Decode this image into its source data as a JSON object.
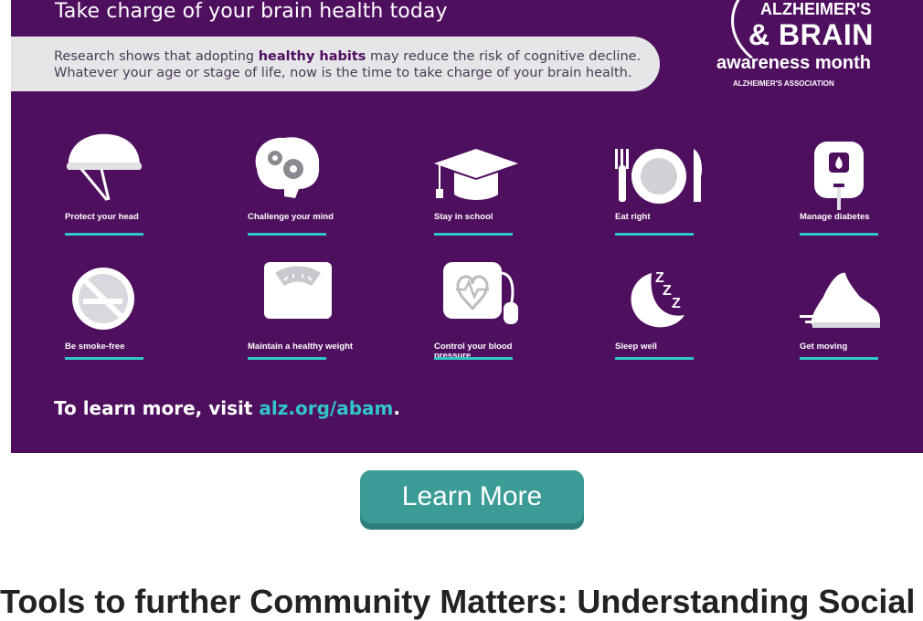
{
  "banner": {
    "title": "Take charge of your brain health today",
    "pill_pre": "Research shows that adopting ",
    "pill_bold": "healthy habits",
    "pill_post": " may reduce the risk of cognitive decline.",
    "pill_line2": "Whatever your age or stage of life, now is the time to take charge of your brain health.",
    "logo": {
      "line1": "ALZHEIMER'S",
      "line2": "& BRAIN",
      "line3": "awareness month",
      "line4": "ALZHEIMER'S ASSOCIATION"
    },
    "tiles": [
      {
        "icon": "helmet-icon",
        "label": "Protect your head"
      },
      {
        "icon": "brain-gears-icon",
        "label": "Challenge your mind"
      },
      {
        "icon": "graduation-cap-icon",
        "label": "Stay in school"
      },
      {
        "icon": "plate-fork-knife-icon",
        "label": "Eat right"
      },
      {
        "icon": "glucose-meter-icon",
        "label": "Manage diabetes"
      },
      {
        "icon": "no-smoking-icon",
        "label": "Be smoke-free"
      },
      {
        "icon": "scale-icon",
        "label": "Maintain a healthy weight"
      },
      {
        "icon": "blood-pressure-monitor-icon",
        "label": "Control your blood pressure"
      },
      {
        "icon": "moon-zzz-icon",
        "label": "Sleep well"
      },
      {
        "icon": "sneaker-icon",
        "label": "Get moving"
      }
    ],
    "learn_pre": "To learn more, visit ",
    "learn_link": "alz.org/abam",
    "learn_post": "."
  },
  "button": {
    "label": "Learn More"
  },
  "bottom_text": "Tools to further Community Matters: Understanding Social"
}
